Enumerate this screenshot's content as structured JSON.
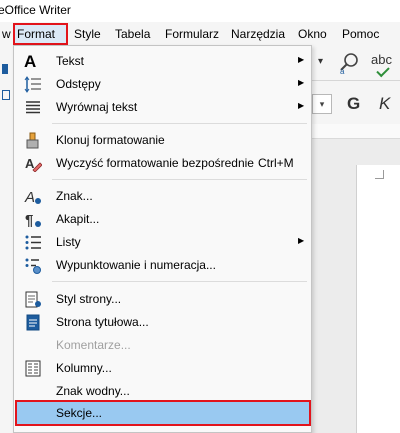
{
  "window": {
    "title": "eOffice Writer"
  },
  "menubar": {
    "items": [
      {
        "label": "w"
      },
      {
        "label": "Format"
      },
      {
        "label": "Style"
      },
      {
        "label": "Tabela"
      },
      {
        "label": "Formularz"
      },
      {
        "label": "Narzędzia"
      },
      {
        "label": "Okno"
      },
      {
        "label": "Pomoc"
      }
    ]
  },
  "toolbar": {
    "spellcheck_text": "abc",
    "bold_label": "G",
    "italic_label": "K"
  },
  "format_menu": {
    "items": [
      {
        "label": "Tekst",
        "icon": "text-A-icon",
        "submenu": true
      },
      {
        "label": "Odstępy",
        "icon": "spacing-icon",
        "submenu": true
      },
      {
        "label": "Wyrównaj tekst",
        "icon": "align-icon",
        "submenu": true
      },
      {
        "label": "Klonuj formatowanie",
        "icon": "clone-brush-icon"
      },
      {
        "label": "Wyczyść formatowanie bezpośrednie",
        "icon": "clear-format-icon",
        "shortcut": "Ctrl+M"
      },
      {
        "label": "Znak...",
        "icon": "character-icon"
      },
      {
        "label": "Akapit...",
        "icon": "paragraph-icon"
      },
      {
        "label": "Listy",
        "icon": "lists-icon",
        "submenu": true
      },
      {
        "label": "Wypunktowanie i numeracja...",
        "icon": "bullets-numbering-icon"
      },
      {
        "label": "Styl strony...",
        "icon": "page-style-icon"
      },
      {
        "label": "Strona tytułowa...",
        "icon": "title-page-icon"
      },
      {
        "label": "Komentarze...",
        "disabled": true
      },
      {
        "label": "Kolumny...",
        "icon": "columns-icon"
      },
      {
        "label": "Znak wodny..."
      },
      {
        "label": "Sekcje...",
        "selected": true
      }
    ]
  }
}
